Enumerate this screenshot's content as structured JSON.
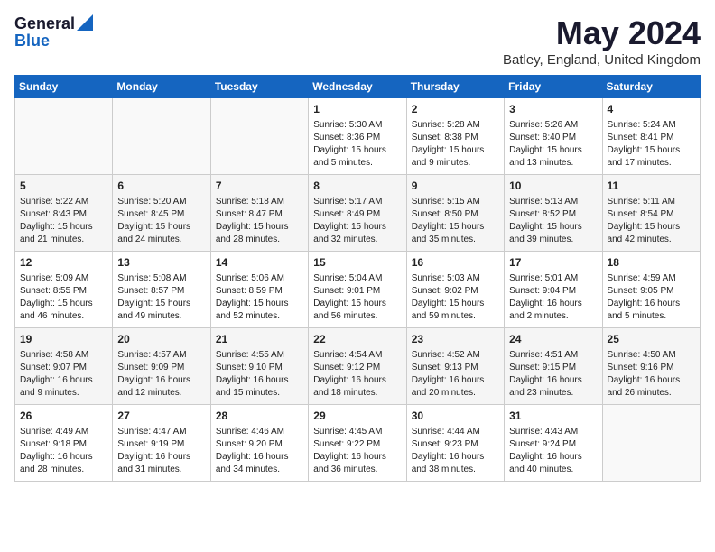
{
  "header": {
    "logo_line1": "General",
    "logo_line2": "Blue",
    "month": "May 2024",
    "location": "Batley, England, United Kingdom"
  },
  "weekdays": [
    "Sunday",
    "Monday",
    "Tuesday",
    "Wednesday",
    "Thursday",
    "Friday",
    "Saturday"
  ],
  "weeks": [
    [
      {
        "day": "",
        "info": ""
      },
      {
        "day": "",
        "info": ""
      },
      {
        "day": "",
        "info": ""
      },
      {
        "day": "1",
        "info": "Sunrise: 5:30 AM\nSunset: 8:36 PM\nDaylight: 15 hours\nand 5 minutes."
      },
      {
        "day": "2",
        "info": "Sunrise: 5:28 AM\nSunset: 8:38 PM\nDaylight: 15 hours\nand 9 minutes."
      },
      {
        "day": "3",
        "info": "Sunrise: 5:26 AM\nSunset: 8:40 PM\nDaylight: 15 hours\nand 13 minutes."
      },
      {
        "day": "4",
        "info": "Sunrise: 5:24 AM\nSunset: 8:41 PM\nDaylight: 15 hours\nand 17 minutes."
      }
    ],
    [
      {
        "day": "5",
        "info": "Sunrise: 5:22 AM\nSunset: 8:43 PM\nDaylight: 15 hours\nand 21 minutes."
      },
      {
        "day": "6",
        "info": "Sunrise: 5:20 AM\nSunset: 8:45 PM\nDaylight: 15 hours\nand 24 minutes."
      },
      {
        "day": "7",
        "info": "Sunrise: 5:18 AM\nSunset: 8:47 PM\nDaylight: 15 hours\nand 28 minutes."
      },
      {
        "day": "8",
        "info": "Sunrise: 5:17 AM\nSunset: 8:49 PM\nDaylight: 15 hours\nand 32 minutes."
      },
      {
        "day": "9",
        "info": "Sunrise: 5:15 AM\nSunset: 8:50 PM\nDaylight: 15 hours\nand 35 minutes."
      },
      {
        "day": "10",
        "info": "Sunrise: 5:13 AM\nSunset: 8:52 PM\nDaylight: 15 hours\nand 39 minutes."
      },
      {
        "day": "11",
        "info": "Sunrise: 5:11 AM\nSunset: 8:54 PM\nDaylight: 15 hours\nand 42 minutes."
      }
    ],
    [
      {
        "day": "12",
        "info": "Sunrise: 5:09 AM\nSunset: 8:55 PM\nDaylight: 15 hours\nand 46 minutes."
      },
      {
        "day": "13",
        "info": "Sunrise: 5:08 AM\nSunset: 8:57 PM\nDaylight: 15 hours\nand 49 minutes."
      },
      {
        "day": "14",
        "info": "Sunrise: 5:06 AM\nSunset: 8:59 PM\nDaylight: 15 hours\nand 52 minutes."
      },
      {
        "day": "15",
        "info": "Sunrise: 5:04 AM\nSunset: 9:01 PM\nDaylight: 15 hours\nand 56 minutes."
      },
      {
        "day": "16",
        "info": "Sunrise: 5:03 AM\nSunset: 9:02 PM\nDaylight: 15 hours\nand 59 minutes."
      },
      {
        "day": "17",
        "info": "Sunrise: 5:01 AM\nSunset: 9:04 PM\nDaylight: 16 hours\nand 2 minutes."
      },
      {
        "day": "18",
        "info": "Sunrise: 4:59 AM\nSunset: 9:05 PM\nDaylight: 16 hours\nand 5 minutes."
      }
    ],
    [
      {
        "day": "19",
        "info": "Sunrise: 4:58 AM\nSunset: 9:07 PM\nDaylight: 16 hours\nand 9 minutes."
      },
      {
        "day": "20",
        "info": "Sunrise: 4:57 AM\nSunset: 9:09 PM\nDaylight: 16 hours\nand 12 minutes."
      },
      {
        "day": "21",
        "info": "Sunrise: 4:55 AM\nSunset: 9:10 PM\nDaylight: 16 hours\nand 15 minutes."
      },
      {
        "day": "22",
        "info": "Sunrise: 4:54 AM\nSunset: 9:12 PM\nDaylight: 16 hours\nand 18 minutes."
      },
      {
        "day": "23",
        "info": "Sunrise: 4:52 AM\nSunset: 9:13 PM\nDaylight: 16 hours\nand 20 minutes."
      },
      {
        "day": "24",
        "info": "Sunrise: 4:51 AM\nSunset: 9:15 PM\nDaylight: 16 hours\nand 23 minutes."
      },
      {
        "day": "25",
        "info": "Sunrise: 4:50 AM\nSunset: 9:16 PM\nDaylight: 16 hours\nand 26 minutes."
      }
    ],
    [
      {
        "day": "26",
        "info": "Sunrise: 4:49 AM\nSunset: 9:18 PM\nDaylight: 16 hours\nand 28 minutes."
      },
      {
        "day": "27",
        "info": "Sunrise: 4:47 AM\nSunset: 9:19 PM\nDaylight: 16 hours\nand 31 minutes."
      },
      {
        "day": "28",
        "info": "Sunrise: 4:46 AM\nSunset: 9:20 PM\nDaylight: 16 hours\nand 34 minutes."
      },
      {
        "day": "29",
        "info": "Sunrise: 4:45 AM\nSunset: 9:22 PM\nDaylight: 16 hours\nand 36 minutes."
      },
      {
        "day": "30",
        "info": "Sunrise: 4:44 AM\nSunset: 9:23 PM\nDaylight: 16 hours\nand 38 minutes."
      },
      {
        "day": "31",
        "info": "Sunrise: 4:43 AM\nSunset: 9:24 PM\nDaylight: 16 hours\nand 40 minutes."
      },
      {
        "day": "",
        "info": ""
      }
    ]
  ]
}
